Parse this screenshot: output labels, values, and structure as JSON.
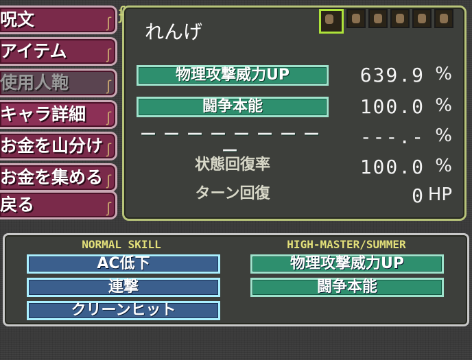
{
  "menu": {
    "items": [
      {
        "label": "呪文",
        "state": "normal"
      },
      {
        "label": "アイテム",
        "state": "normal"
      },
      {
        "label": "使用人鞄",
        "state": "disabled"
      },
      {
        "label": "キャラ詳細",
        "state": "active"
      },
      {
        "label": "お金を山分け",
        "state": "normal"
      },
      {
        "label": "お金を集める",
        "state": "normal"
      },
      {
        "label": "戻る",
        "state": "normal"
      }
    ]
  },
  "status": {
    "character_name": "れんげ",
    "party_portraits": [
      "portrait-1",
      "portrait-2",
      "portrait-3",
      "portrait-4",
      "portrait-5",
      "portrait-6"
    ],
    "selected_portrait_index": 0,
    "rows": [
      {
        "label": "物理攻撃威力UP",
        "value": "639.9",
        "unit": "%",
        "style": "box"
      },
      {
        "label": "闘争本能",
        "value": "100.0",
        "unit": "%",
        "style": "box"
      },
      {
        "label": "－－－－－－－－－",
        "value": "---.-",
        "unit": "%",
        "style": "dash"
      },
      {
        "label": "状態回復率",
        "value": "100.0",
        "unit": "%",
        "style": "plain"
      },
      {
        "label": "ターン回復",
        "value": "0",
        "unit": "HP",
        "style": "plain"
      }
    ]
  },
  "skills": {
    "normal_heading": "NORMAL SKILL",
    "high_heading": "HIGH-MASTER/SUMMER",
    "normal": [
      "AC低下",
      "連撃",
      "クリーンヒット"
    ],
    "high": [
      "物理攻撃威力UP",
      "闘争本能"
    ]
  },
  "colors": {
    "menu_bg": "#7a2a4a",
    "panel_border": "#b8c47a",
    "green_box": "#2e8f6e",
    "blue_box": "#3b5f8d",
    "selected_portrait_border": "#aee33a",
    "skill_heading": "#e3e07a"
  }
}
